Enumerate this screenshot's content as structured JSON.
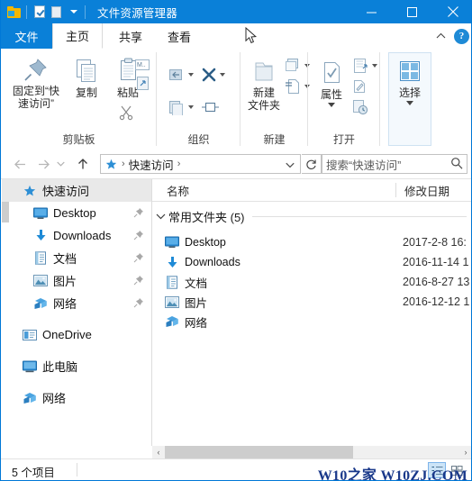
{
  "window": {
    "title": "文件资源管理器",
    "quick_access_toolbar": [
      {
        "name": "explorer-icon",
        "label": "文件资源管理器"
      },
      {
        "name": "properties-icon",
        "label": "属性"
      },
      {
        "name": "new-folder-icon",
        "label": "新建文件夹"
      },
      {
        "name": "customize-qat-icon",
        "label": "自定义快速访问工具栏"
      }
    ],
    "controls": {
      "minimize": "最小化",
      "maximize": "最大化",
      "close": "关闭"
    }
  },
  "tabs": [
    {
      "id": "file",
      "label": "文件",
      "selected": false,
      "is_file_menu": true
    },
    {
      "id": "home",
      "label": "主页",
      "selected": true,
      "is_file_menu": false
    },
    {
      "id": "share",
      "label": "共享",
      "selected": false,
      "is_file_menu": false
    },
    {
      "id": "view",
      "label": "查看",
      "selected": false,
      "is_file_menu": false
    }
  ],
  "ribbon_helpers": {
    "collapse_label": "折叠功能区",
    "help_label": "?"
  },
  "ribbon": {
    "groups": [
      {
        "id": "clipboard",
        "label": "剪贴板",
        "buttons": [
          {
            "id": "pin-to-quick-access",
            "label": "固定到“快\n速访问”",
            "line1": "固定到“快",
            "line2": "速访问”"
          },
          {
            "id": "copy",
            "label": "复制"
          },
          {
            "id": "paste",
            "label": "粘贴"
          },
          {
            "id": "cut",
            "label": "剪切"
          },
          {
            "id": "copy-path",
            "label": "复制路径"
          },
          {
            "id": "paste-shortcut",
            "label": "粘贴快捷方式"
          }
        ]
      },
      {
        "id": "organize",
        "label": "组织",
        "buttons": [
          {
            "id": "move-to",
            "label": "移动到"
          },
          {
            "id": "copy-to",
            "label": "复制到"
          },
          {
            "id": "delete",
            "label": "删除"
          },
          {
            "id": "rename",
            "label": "重命名"
          }
        ]
      },
      {
        "id": "new",
        "label": "新建",
        "buttons": [
          {
            "id": "new-folder",
            "line1": "新建",
            "line2": "文件夹",
            "label": "新建文件夹"
          },
          {
            "id": "new-item",
            "label": "新建项目"
          },
          {
            "id": "easy-access",
            "label": "轻松访问"
          }
        ]
      },
      {
        "id": "open",
        "label": "打开",
        "buttons": [
          {
            "id": "properties",
            "label": "属性"
          },
          {
            "id": "open-with",
            "label": "打开"
          },
          {
            "id": "edit",
            "label": "编辑"
          },
          {
            "id": "history",
            "label": "历史记录"
          }
        ]
      },
      {
        "id": "select",
        "label": "",
        "buttons": [
          {
            "id": "select",
            "label": "选择"
          }
        ]
      }
    ]
  },
  "addressbar": {
    "back": "后退",
    "forward": "前进",
    "recent": "最近浏览的位置",
    "up": "上移到",
    "breadcrumb": {
      "icon": "quick-access-star-icon",
      "items": [
        "快速访问"
      ]
    },
    "dropdown": "以前的位置",
    "refresh": "刷新",
    "search_placeholder": "搜索“快速访问”",
    "search_value": "",
    "search_icon": "search-icon"
  },
  "sidebar": {
    "items": [
      {
        "id": "quick-access",
        "label": "快速访问",
        "icon": "star-icon",
        "indent": 0,
        "selected": true,
        "pinned": false
      },
      {
        "id": "desktop",
        "label": "Desktop",
        "icon": "desktop-icon",
        "indent": 1,
        "selected": false,
        "pinned": true
      },
      {
        "id": "downloads",
        "label": "Downloads",
        "icon": "download-icon",
        "indent": 1,
        "selected": false,
        "pinned": true
      },
      {
        "id": "documents",
        "label": "文档",
        "icon": "documents-icon",
        "indent": 1,
        "selected": false,
        "pinned": true
      },
      {
        "id": "pictures",
        "label": "图片",
        "icon": "pictures-icon",
        "indent": 1,
        "selected": false,
        "pinned": true
      },
      {
        "id": "network-qa",
        "label": "网络",
        "icon": "network-icon",
        "indent": 1,
        "selected": false,
        "pinned": true
      },
      {
        "id": "onedrive",
        "label": "OneDrive",
        "icon": "onedrive-icon",
        "indent": 0,
        "selected": false,
        "pinned": false
      },
      {
        "id": "this-pc",
        "label": "此电脑",
        "icon": "this-pc-icon",
        "indent": 0,
        "selected": false,
        "pinned": false
      },
      {
        "id": "network",
        "label": "网络",
        "icon": "network-icon",
        "indent": 0,
        "selected": false,
        "pinned": false
      }
    ]
  },
  "filelist": {
    "columns": [
      {
        "id": "name",
        "label": "名称"
      },
      {
        "id": "date",
        "label": "修改日期"
      }
    ],
    "group": {
      "label": "常用文件夹 (5)",
      "expanded": true
    },
    "rows": [
      {
        "name": "Desktop",
        "icon": "desktop-icon",
        "date": "2017-2-8 16:"
      },
      {
        "name": "Downloads",
        "icon": "download-icon",
        "date": "2016-11-14 1"
      },
      {
        "name": "文档",
        "icon": "documents-icon",
        "date": "2016-8-27 13"
      },
      {
        "name": "图片",
        "icon": "pictures-icon",
        "date": "2016-12-12 1"
      },
      {
        "name": "网络",
        "icon": "network-icon",
        "date": ""
      }
    ]
  },
  "scrollbar": {
    "left_arrow": "‹",
    "right_arrow": "›"
  },
  "statusbar": {
    "item_count": "5 个项目",
    "view_details_label": "详细信息",
    "view_large_icons_label": "大图标",
    "watermark": "W10之家 W10ZJ.COM"
  },
  "colors": {
    "title_bar": "#0a80d8",
    "accent": "#0a80d8",
    "selection": "#cce4f7",
    "selected_nav": "#e9e9e9",
    "watermark": "#19388a"
  }
}
